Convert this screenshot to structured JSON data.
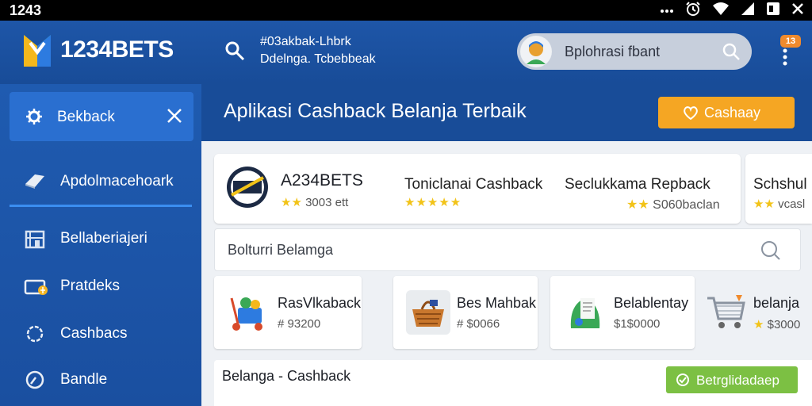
{
  "status_bar": {
    "time": "1243",
    "icons": [
      "more-dots-icon",
      "alarm-icon",
      "wifi-icon",
      "signal-icon",
      "battery-icon",
      "close-icon"
    ]
  },
  "header": {
    "brand": "1234BETS",
    "tagline_line1": "#03akbak-Lhbrk",
    "tagline_line2": "Ddelnga. Tcbebbeak",
    "user_name": "Bplohrasi fbant",
    "notification_count": "13"
  },
  "sidebar": {
    "active_item": {
      "label": "Bekback",
      "icon": "gear-icon"
    },
    "items": [
      {
        "label": "Apdolmacehoark",
        "icon": "tag-icon"
      },
      {
        "label": "Bellaberiajeri",
        "icon": "building-icon"
      },
      {
        "label": "Pratdeks",
        "icon": "wallet-icon"
      },
      {
        "label": "Cashbacs",
        "icon": "badge-icon"
      },
      {
        "label": "Bandle",
        "icon": "clock-icon"
      }
    ]
  },
  "content": {
    "title": "Aplikasi Cashback Belanja Terbaik",
    "cta_label": "Cashaay",
    "store": {
      "name": "A234BETS",
      "rating": "3003 ett",
      "offer1_title": "Toniclanai Cashback",
      "offer2_title": "Seclukkama Repback",
      "offer2_rating": "S060baclan"
    },
    "store2": {
      "title": "Schshul",
      "rating": "vcasl"
    },
    "search_placeholder": "Bolturri Belamga",
    "products": [
      {
        "name": "RasVlkaback",
        "price": "# 93200"
      },
      {
        "name": "Bes Mahbak",
        "price": "# $0066"
      },
      {
        "name": "Belablentay",
        "price": "$1$0000"
      },
      {
        "name": "belanja",
        "price": "$3000"
      }
    ],
    "section_label": "Belanga - Cashback",
    "section_button": "Betrglidadaep"
  },
  "colors": {
    "header_blue": "#1e56a8",
    "sidebar_active": "#2a6fd0",
    "cta_orange": "#f5a623",
    "green_button": "#7cc043",
    "star_yellow": "#f2c318"
  }
}
